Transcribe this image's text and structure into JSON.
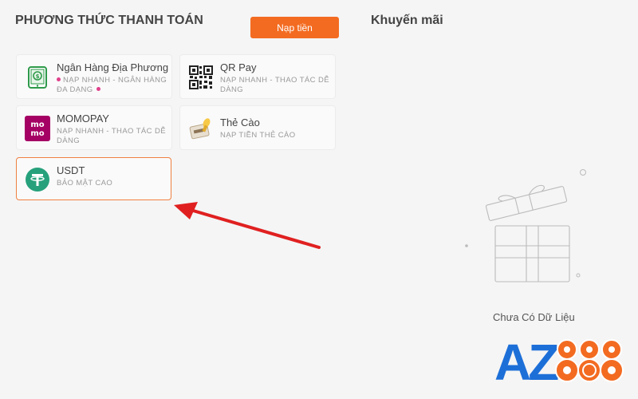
{
  "payment": {
    "title": "PHƯƠNG THỨC THANH TOÁN",
    "deposit_label": "Nạp tiền",
    "methods": [
      {
        "name": "Ngân Hàng Địa Phương",
        "desc": "NẠP NHANH - NGÂN HÀNG ĐA DẠNG",
        "icon": "bank-phone-icon"
      },
      {
        "name": "QR Pay",
        "desc": "NẠP NHANH - THAO TÁC DỄ DÀNG",
        "icon": "qr-code-icon"
      },
      {
        "name": "MOMOPAY",
        "desc": "NẠP NHANH - THAO TÁC DỄ DÀNG",
        "icon": "momo-logo-icon"
      },
      {
        "name": "Thẻ Cào",
        "desc": "NẠP TIỀN THẺ CÀO",
        "icon": "scratch-card-icon"
      },
      {
        "name": "USDT",
        "desc": "BẢO MẬT CAO",
        "icon": "tether-icon"
      }
    ],
    "selected": "USDT"
  },
  "promo": {
    "title": "Khuyến mãi",
    "empty_text": "Chưa Có Dữ Liệu"
  },
  "brand": {
    "logo_letters": "AZ",
    "logo_digits": "888",
    "accent": "#f36b21",
    "logo_blue": "#1d6fd8",
    "arrow_color": "#e02020"
  }
}
